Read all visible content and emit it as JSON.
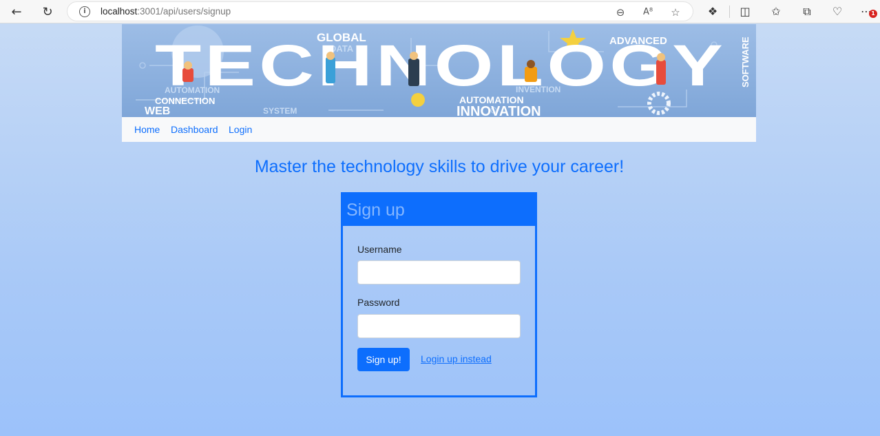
{
  "browser": {
    "url_host": "localhost",
    "url_path": ":3001/api/users/signup",
    "notification_count": "1",
    "icons": [
      "back-arrow-icon",
      "refresh-icon",
      "info-icon",
      "zoom-out-icon",
      "read-aloud-icon",
      "favorite-star-icon",
      "extensions-icon",
      "split-screen-icon",
      "favorites-icon",
      "collections-icon",
      "browser-essentials-icon",
      "more-menu-icon"
    ]
  },
  "banner": {
    "words": {
      "global": "GLOBAL",
      "data": "DATA",
      "advanced": "ADVANCED",
      "technology": "TECHNOLOGY",
      "software": "SOFTWARE",
      "automation_top": "AUTOMATION",
      "connection": "CONNECTION",
      "web": "WEB",
      "system": "SYSTEM",
      "automation": "AUTOMATION",
      "innovation": "INNOVATION",
      "invention": "INVENTION"
    }
  },
  "nav": {
    "home": "Home",
    "dashboard": "Dashboard",
    "login": "Login"
  },
  "headline": "Master the technology skills to drive your career!",
  "form": {
    "title": "Sign up",
    "username_label": "Username",
    "username_value": "",
    "password_label": "Password",
    "password_value": "",
    "submit_label": "Sign up!",
    "alt_link": "Login up instead"
  },
  "colors": {
    "primary": "#0d6efd",
    "header_text": "#86b7fe",
    "navbar_bg": "#f8f9fa"
  }
}
